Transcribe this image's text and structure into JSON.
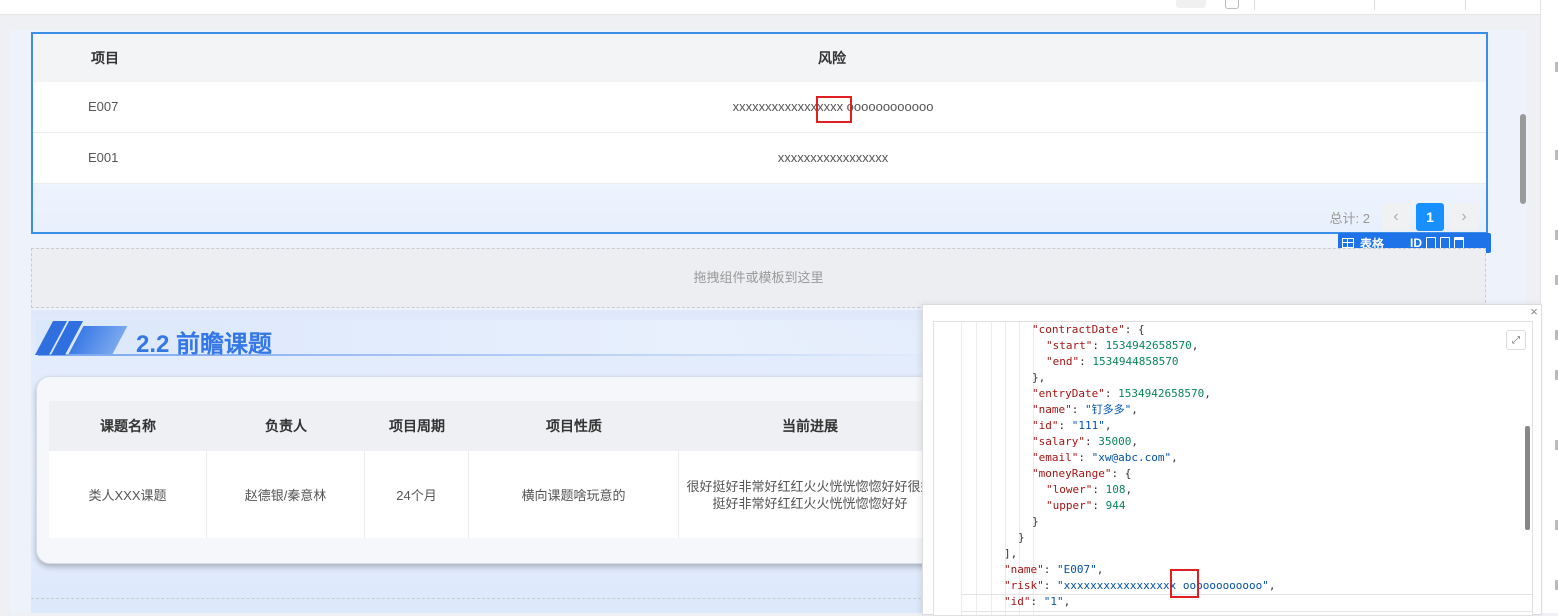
{
  "table": {
    "headers": [
      "项目",
      "风险"
    ],
    "rows": [
      {
        "project": "E007",
        "risk": "xxxxxxxxxxxxxxxxx oooooooooooo"
      },
      {
        "project": "E001",
        "risk": "xxxxxxxxxxxxxxxxx"
      }
    ],
    "total_label": "总计: 2",
    "prev_icon": "chevron-left-icon",
    "current_page": "1",
    "next_icon": "chevron-right-icon"
  },
  "table_toolbar": {
    "table_icon": "grid-icon",
    "table_label": "表格",
    "id_label": "ID",
    "icons": [
      "edit-icon",
      "copy-icon",
      "delete-icon"
    ]
  },
  "dropzone": {
    "text": "拖拽组件或模板到这里"
  },
  "section": {
    "title": "2.2 前瞻课题",
    "headers": [
      "课题名称",
      "负责人",
      "项目周期",
      "项目性质",
      "当前进展"
    ],
    "row": {
      "name": "类人XXX课题",
      "owner": "赵德银/秦意林",
      "period": "24个月",
      "nature": "横向课题啥玩意的",
      "progress": "很好挺好非常好红红火火恍恍惚惚好好很好挺好非常好红红火火恍恍惚惚好好"
    }
  },
  "json_popup": {
    "close_label": "×",
    "expand_icon": "expand-icon",
    "lines": [
      {
        "indent": 6,
        "parts": [
          [
            "k",
            "\"contractDate\""
          ],
          [
            "p",
            ": {"
          ]
        ]
      },
      {
        "indent": 7,
        "parts": [
          [
            "k",
            "\"start\""
          ],
          [
            "p",
            ": "
          ],
          [
            "n",
            "1534942658570"
          ],
          [
            "p",
            ","
          ]
        ]
      },
      {
        "indent": 7,
        "parts": [
          [
            "k",
            "\"end\""
          ],
          [
            "p",
            ": "
          ],
          [
            "n",
            "1534944858570"
          ]
        ]
      },
      {
        "indent": 6,
        "parts": [
          [
            "p",
            "},"
          ]
        ]
      },
      {
        "indent": 6,
        "parts": [
          [
            "k",
            "\"entryDate\""
          ],
          [
            "p",
            ": "
          ],
          [
            "n",
            "1534942658570"
          ],
          [
            "p",
            ","
          ]
        ]
      },
      {
        "indent": 6,
        "parts": [
          [
            "k",
            "\"name\""
          ],
          [
            "p",
            ": "
          ],
          [
            "s",
            "\"钉多多\""
          ],
          [
            "p",
            ","
          ]
        ]
      },
      {
        "indent": 6,
        "parts": [
          [
            "k",
            "\"id\""
          ],
          [
            "p",
            ": "
          ],
          [
            "s",
            "\"111\""
          ],
          [
            "p",
            ","
          ]
        ]
      },
      {
        "indent": 6,
        "parts": [
          [
            "k",
            "\"salary\""
          ],
          [
            "p",
            ": "
          ],
          [
            "n",
            "35000"
          ],
          [
            "p",
            ","
          ]
        ]
      },
      {
        "indent": 6,
        "parts": [
          [
            "k",
            "\"email\""
          ],
          [
            "p",
            ": "
          ],
          [
            "s",
            "\"xw@abc.com\""
          ],
          [
            "p",
            ","
          ]
        ]
      },
      {
        "indent": 6,
        "parts": [
          [
            "k",
            "\"moneyRange\""
          ],
          [
            "p",
            ": {"
          ]
        ]
      },
      {
        "indent": 7,
        "parts": [
          [
            "k",
            "\"lower\""
          ],
          [
            "p",
            ": "
          ],
          [
            "n",
            "108"
          ],
          [
            "p",
            ","
          ]
        ]
      },
      {
        "indent": 7,
        "parts": [
          [
            "k",
            "\"upper\""
          ],
          [
            "p",
            ": "
          ],
          [
            "n",
            "944"
          ]
        ]
      },
      {
        "indent": 6,
        "parts": [
          [
            "p",
            "}"
          ]
        ]
      },
      {
        "indent": 5,
        "parts": [
          [
            "p",
            "}"
          ]
        ]
      },
      {
        "indent": 4,
        "parts": [
          [
            "p",
            "],"
          ]
        ]
      },
      {
        "indent": 4,
        "parts": [
          [
            "k",
            "\"name\""
          ],
          [
            "p",
            ": "
          ],
          [
            "s",
            "\"E007\""
          ],
          [
            "p",
            ","
          ]
        ]
      },
      {
        "indent": 4,
        "parts": [
          [
            "k",
            "\"risk\""
          ],
          [
            "p",
            ": "
          ],
          [
            "s",
            "\"xxxxxxxxxxxxxxxxx oooooooooooo\""
          ],
          [
            "p",
            ","
          ]
        ]
      },
      {
        "indent": 4,
        "parts": [
          [
            "k",
            "\"id\""
          ],
          [
            "p",
            ": "
          ],
          [
            "s",
            "\"1\""
          ],
          [
            "p",
            ","
          ]
        ]
      }
    ]
  },
  "highlight_color": "#e02020",
  "accent_color": "#1890ff"
}
